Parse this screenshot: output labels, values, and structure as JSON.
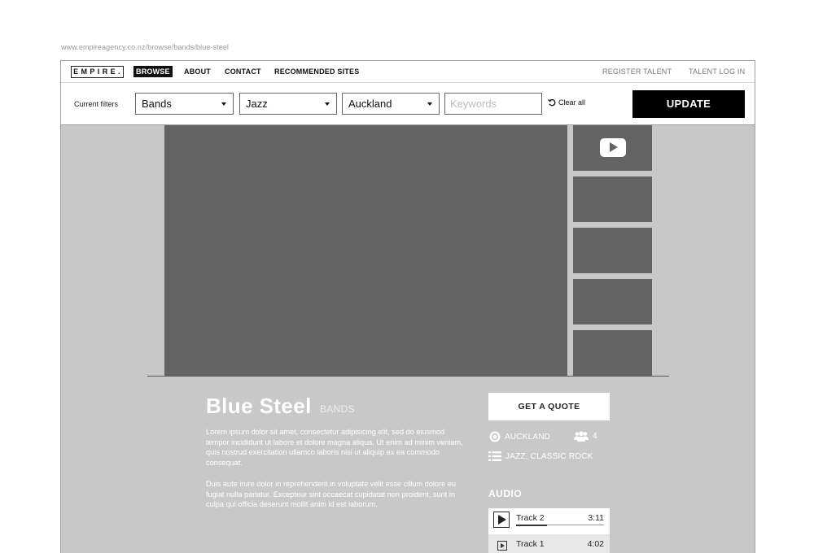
{
  "url": "www.empireagency.co.nz/browse/bands/blue-steel",
  "nav": {
    "logo": "EMPIRE.",
    "items": [
      "BROWSE",
      "ABOUT",
      "CONTACT",
      "RECOMMENDED SITES"
    ],
    "active": "BROWSE",
    "right": [
      "REGISTER TALENT",
      "TALENT LOG IN"
    ]
  },
  "filters": {
    "label": "Current filters",
    "category": "Bands",
    "genre": "Jazz",
    "location": "Auckland",
    "keywords_placeholder": "Keywords",
    "clear_label": "Clear all",
    "update_label": "UPDATE"
  },
  "media": {
    "video_icon": "play-icon"
  },
  "profile": {
    "name": "Blue Steel",
    "category": "BANDS",
    "paragraphs": [
      "Lorem ipsum dolor sit amet, consectetur adipisicing elit, sed do eiusmod tempor incididunt ut labore et dolore magna aliqua. Ut enim ad minim veniam, quis nostrud exercitation ullamco laboris nisi ut aliquip ex ea commodo consequat.",
      "Duis aute irure dolor in reprehenderit in voluptate velit esse cillum dolore eu fugiat nulla pariatur. Excepteur sint occaecat cupidatat non proident, sunt in culpa qui officia deserunt mollit anim id est laborum."
    ],
    "quote_label": "GET A QUOTE",
    "location": "AUCKLAND",
    "members": "4",
    "genres": "JAZZ, CLASSIC ROCK"
  },
  "audio": {
    "title": "AUDIO",
    "tracks": [
      {
        "name": "Track 2",
        "time": "3:11",
        "playing": true,
        "progress": 0.35
      },
      {
        "name": "Track 1",
        "time": "4:02",
        "playing": false
      }
    ]
  },
  "colors": {
    "page_bg": "#c8c8c8",
    "media_placeholder": "#636363",
    "accent": "#000000"
  }
}
